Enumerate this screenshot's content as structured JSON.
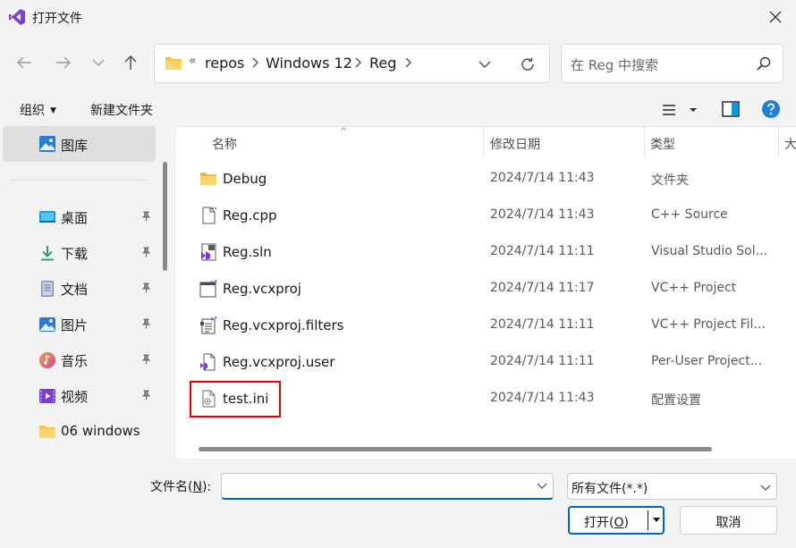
{
  "window": {
    "title": "打开文件"
  },
  "address": {
    "overflow": "«",
    "crumbs": [
      "repos",
      "Windows 12",
      "Reg"
    ]
  },
  "search": {
    "placeholder": "在 Reg 中搜索"
  },
  "toolbar": {
    "organize": "组织",
    "new_folder": "新建文件夹"
  },
  "sidebar": {
    "gallery": "图库",
    "items": [
      {
        "label": "桌面",
        "icon": "desktop-icon",
        "pinned": true
      },
      {
        "label": "下载",
        "icon": "download-icon",
        "pinned": true
      },
      {
        "label": "文档",
        "icon": "document-icon",
        "pinned": true
      },
      {
        "label": "图片",
        "icon": "pictures-icon",
        "pinned": true
      },
      {
        "label": "音乐",
        "icon": "music-icon",
        "pinned": true
      },
      {
        "label": "视频",
        "icon": "videos-icon",
        "pinned": true
      },
      {
        "label": "06 windows",
        "icon": "folder-icon",
        "pinned": false
      }
    ]
  },
  "columns": {
    "name": "名称",
    "modified": "修改日期",
    "type": "类型",
    "size": "大"
  },
  "files": [
    {
      "name": "Debug",
      "date": "2024/7/14 11:43",
      "type": "文件夹",
      "icon": "folder-icon"
    },
    {
      "name": "Reg.cpp",
      "date": "2024/7/14 11:43",
      "type": "C++ Source",
      "icon": "cpp-file-icon"
    },
    {
      "name": "Reg.sln",
      "date": "2024/7/14 11:11",
      "type": "Visual Studio Sol...",
      "icon": "solution-file-icon"
    },
    {
      "name": "Reg.vcxproj",
      "date": "2024/7/14 11:17",
      "type": "VC++ Project",
      "icon": "vcxproj-file-icon"
    },
    {
      "name": "Reg.vcxproj.filters",
      "date": "2024/7/14 11:11",
      "type": "VC++ Project Fil...",
      "icon": "filters-file-icon"
    },
    {
      "name": "Reg.vcxproj.user",
      "date": "2024/7/14 11:11",
      "type": "Per-User Project...",
      "icon": "user-file-icon"
    },
    {
      "name": "test.ini",
      "date": "2024/7/14 11:43",
      "type": "配置设置",
      "icon": "ini-file-icon"
    }
  ],
  "bottom": {
    "filename_label_pre": "文件名(",
    "filename_label_key": "N",
    "filename_label_post": "):",
    "filename_value": "",
    "filetype": "所有文件(*.*)",
    "open_pre": "打开(",
    "open_key": "O",
    "open_post": ")",
    "cancel": "取消"
  },
  "colors": {
    "accent": "#0067c0",
    "highlight": "#e00000",
    "folder": "#f7c34a",
    "vs_purple": "#7b3ed6"
  }
}
